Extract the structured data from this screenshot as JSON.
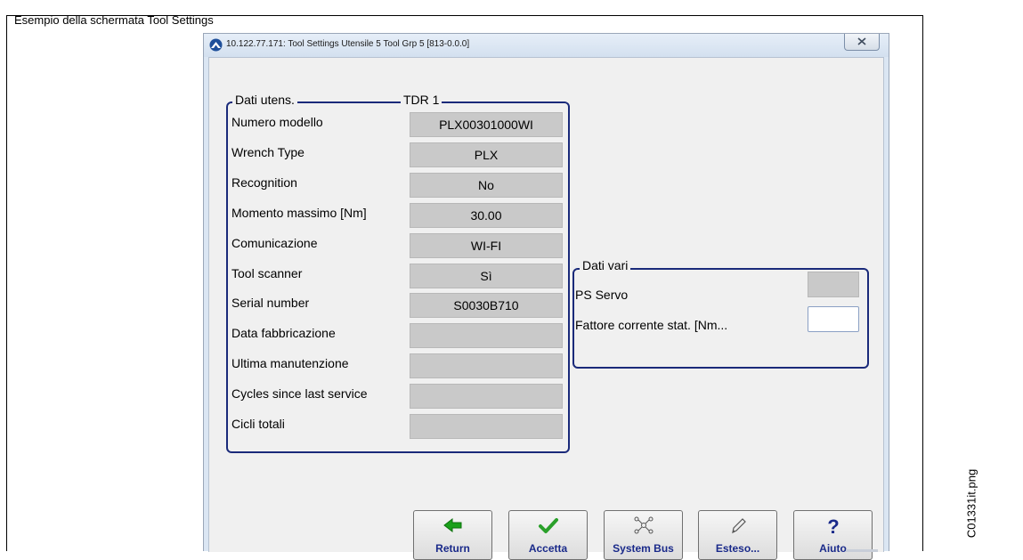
{
  "document": {
    "caption": "Esempio della schermata Tool Settings",
    "side_label": "C01331it.png"
  },
  "window": {
    "title": "10.122.77.171: Tool Settings  Utensile 5  Tool Grp 5 [813-0.0.0]",
    "icon": "app-logo-icon",
    "close_icon": "close-icon"
  },
  "tool_group": {
    "legend": "Dati utens.",
    "header_value": "TDR 1",
    "rows": [
      {
        "label": "Numero modello",
        "value": "PLX00301000WI"
      },
      {
        "label": "Wrench Type",
        "value": "PLX"
      },
      {
        "label": "Recognition",
        "value": "No"
      },
      {
        "label": "Momento massimo  [Nm]",
        "value": "30.00"
      },
      {
        "label": "Comunicazione",
        "value": "WI-FI"
      },
      {
        "label": "Tool scanner",
        "value": "Sì"
      },
      {
        "label": "Serial number",
        "value": "S0030B710"
      },
      {
        "label": "Data fabbricazione",
        "value": ""
      },
      {
        "label": "Ultima manutenzione",
        "value": ""
      },
      {
        "label": "Cycles since last service",
        "value": ""
      },
      {
        "label": "Cicli totali",
        "value": ""
      }
    ]
  },
  "misc_group": {
    "legend": "Dati vari",
    "rows": [
      {
        "label": "PS Servo",
        "value": ""
      },
      {
        "label": "Fattore corrente stat. [Nm...",
        "value": ""
      }
    ]
  },
  "buttons": [
    {
      "label": "Return",
      "icon": "arrow-left-icon",
      "color": "#1aa01a"
    },
    {
      "label": "Accetta",
      "icon": "checkmark-icon",
      "color": "#2aa02a"
    },
    {
      "label": "System Bus",
      "icon": "network-icon",
      "color": "#555555"
    },
    {
      "label": "Esteso...",
      "icon": "pen-icon",
      "color": "#555555"
    },
    {
      "label": "Aiuto",
      "icon": "question-mark-icon",
      "color": "#1a2a8a"
    }
  ]
}
